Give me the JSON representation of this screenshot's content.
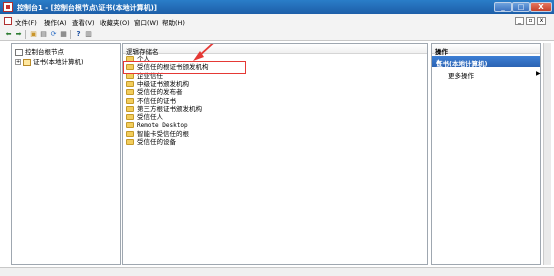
{
  "window": {
    "title": "控制台1 - [控制台根节点\\证书(本地计算机)]",
    "minimize": "_",
    "maximize": "□",
    "close": "X"
  },
  "menu": {
    "items": [
      "文件(F)",
      "操作(A)",
      "查看(V)",
      "收藏夹(O)",
      "窗口(W)",
      "帮助(H)"
    ],
    "sub_controls": [
      "_",
      "▫",
      "x"
    ]
  },
  "toolbar": {
    "buttons": [
      "back-icon",
      "forward-icon",
      "up-folder-icon",
      "console-tree-icon",
      "refresh-icon",
      "export-icon",
      "help-icon",
      "show-hide-action-icon"
    ]
  },
  "tree": {
    "root": "控制台根节点",
    "child": "证书(本地计算机)",
    "expander": "+"
  },
  "list": {
    "column_header": "逻辑存储名",
    "items": [
      "个人",
      "受信任的根证书颁发机构",
      "企业信任",
      "中级证书颁发机构",
      "受信任的发布者",
      "不信任的证书",
      "第三方根证书颁发机构",
      "受信任人",
      "Remote Desktop",
      "智能卡受信任的根",
      "受信任的设备"
    ],
    "highlighted_index": 1
  },
  "actions": {
    "header": "操作",
    "section_title": "证书(本地计算机)",
    "section_caret": "▲",
    "more_actions": "更多操作",
    "more_caret": "▶"
  },
  "colors": {
    "titlebar": "#1d5ea8",
    "selection_blue": "#2b63b3",
    "annotation_red": "#e53935",
    "folder_yellow": "#f2cd5c"
  }
}
